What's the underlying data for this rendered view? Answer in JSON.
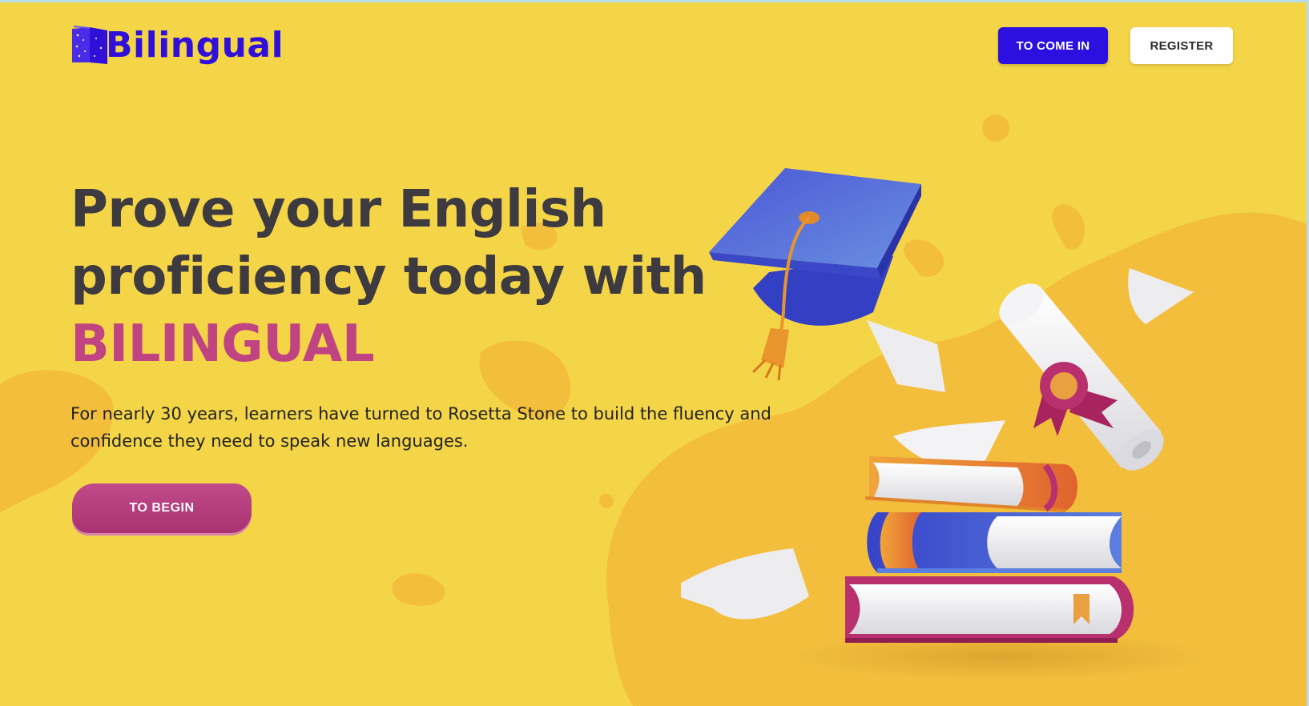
{
  "header": {
    "logo_text": "Bilingual",
    "login_label": "TO COME IN",
    "register_label": "REGISTER"
  },
  "hero": {
    "title_line1": "Prove your English",
    "title_line2": "proficiency today with",
    "title_brand": "BILINGUAL",
    "description": "For nearly 30 years, learners have turned to Rosetta Stone to build the fluency and confidence they need to speak new languages.",
    "cta_label": "TO BEGIN"
  },
  "colors": {
    "background": "#F5D548",
    "primary_button": "#2C10E0",
    "brand_accent": "#C04382",
    "title_text": "#3E3B40"
  },
  "icons": {
    "logo": "book-icon",
    "illustration": "graduation-illustration"
  }
}
